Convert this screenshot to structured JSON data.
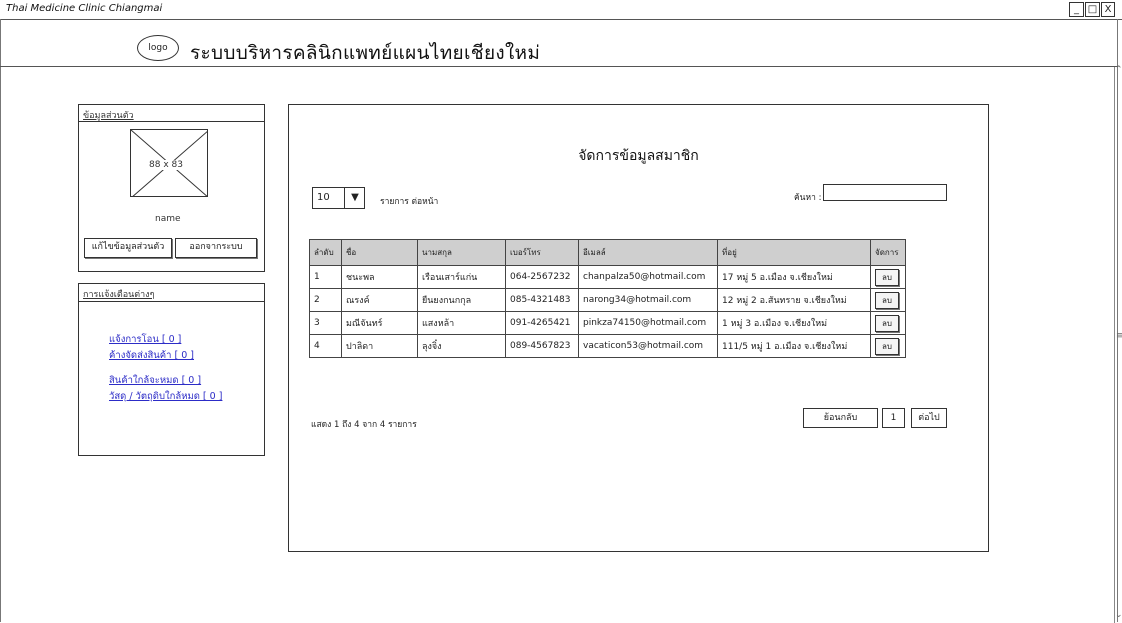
{
  "window": {
    "title": "Thai Medicine Clinic Chiangmai",
    "minimize": "_",
    "maximize": "□",
    "close": "X"
  },
  "header": {
    "logo": "logo",
    "app_title": "ระบบบริหารคลินิกแพทย์แผนไทยเชียงใหม่"
  },
  "profile": {
    "heading": "ข้อมูลส่วนตัว",
    "image_label": "88 x 83",
    "name": "name",
    "edit_button": "แก้ไขข้อมูลส่วนตัว",
    "logout_button": "ออกจากระบบ"
  },
  "notifications": {
    "heading": "การแจ้งเตือนต่างๆ",
    "links": [
      "แจ้งการโอน [ 0 ]",
      "ค้างจัดส่งสินค้า [ 0 ]",
      "สินค้าใกล้จะหมด [ 0 ]",
      "วัสดุ / วัตถุดิบใกล้หมด [ 0 ]"
    ]
  },
  "main": {
    "title": "จัดการข้อมูลสมาชิก",
    "page_size": "10",
    "page_size_arrow": "▼",
    "per_page_label": "รายการ ต่อหน้า",
    "search_label": "ค้นหา :",
    "search_value": "",
    "columns": [
      "ลำดับ",
      "ชื่อ",
      "นามสกุล",
      "เบอร์โทร",
      "อีเมลล์",
      "ที่อยู่",
      "จัดการ"
    ],
    "rows": [
      [
        "1",
        "ชนะพล",
        "เรือนเสาร์แก่น",
        "064-2567232",
        "chanpalza50@hotmail.com",
        "17 หมู่ 5 อ.เมือง จ.เชียงใหม่"
      ],
      [
        "2",
        "ณรงค์",
        "ยืนยงกนกกุล",
        "085-4321483",
        "narong34@hotmail.com",
        "12 หมู่ 2 อ.สันทราย จ.เชียงใหม่"
      ],
      [
        "3",
        "มณีจันทร์",
        "แสงหล้า",
        "091-4265421",
        "pinkza74150@hotmail.com",
        "1 หมู่ 3 อ.เมือง จ.เชียงใหม่"
      ],
      [
        "4",
        "ปาลิดา",
        "ลุงจิ๋ง",
        "089-4567823",
        "vacaticon53@hotmail.com",
        "111/5 หมู่ 1 อ.เมือง จ.เชียงใหม่"
      ]
    ],
    "delete_label": "ลบ",
    "summary": "แสดง 1 ถึง 4 จาก 4 รายการ",
    "prev_button": "ย้อนกลับ",
    "current_page": "1",
    "next_button": "ต่อไป"
  }
}
